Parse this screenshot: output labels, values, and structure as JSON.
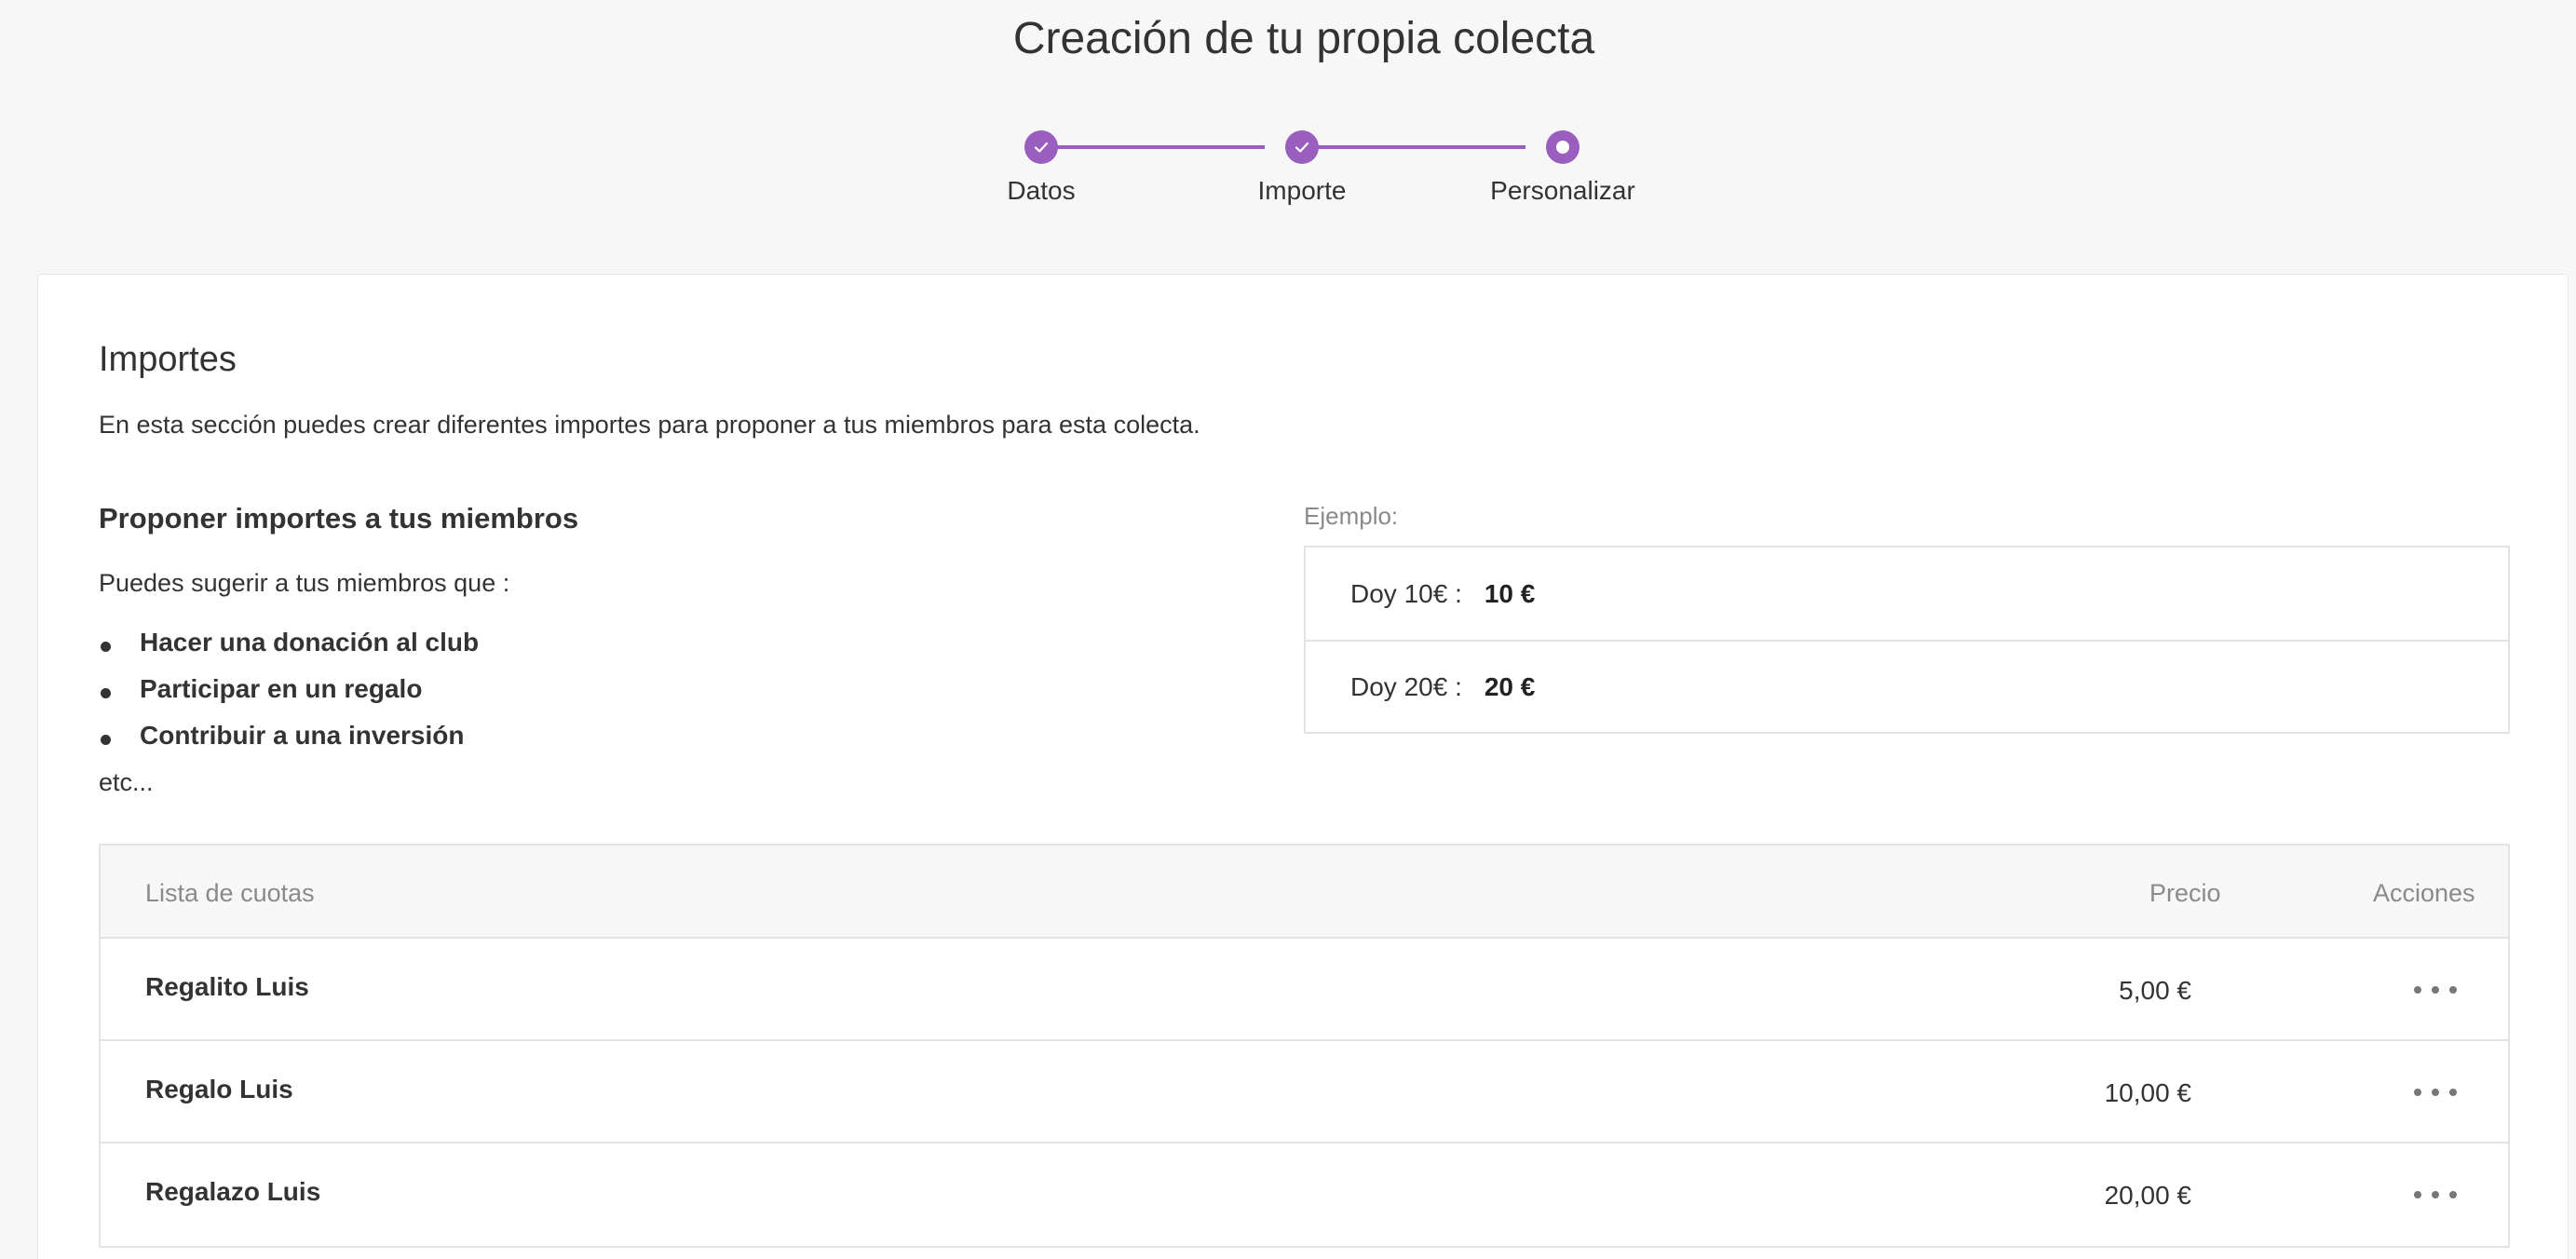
{
  "page": {
    "title": "Creación de tu propia colecta"
  },
  "stepper": {
    "steps": [
      {
        "label": "Datos",
        "state": "done"
      },
      {
        "label": "Importe",
        "state": "done"
      },
      {
        "label": "Personalizar",
        "state": "current"
      }
    ],
    "accent_color": "#9a5ebf"
  },
  "section": {
    "title": "Importes",
    "description": "En esta sección puedes crear diferentes importes para proponer a tus miembros para esta colecta."
  },
  "propose": {
    "title": "Proponer importes a tus miembros",
    "intro": "Puedes sugerir a tus miembros que :",
    "bullets": [
      "Hacer una donación al club",
      "Participar en un regalo",
      "Contribuir a una inversión"
    ],
    "etc": "etc..."
  },
  "example": {
    "label": "Ejemplo:",
    "rows": [
      {
        "label": "Doy 10€ :",
        "value": "10 €"
      },
      {
        "label": "Doy 20€ :",
        "value": "20 €"
      }
    ]
  },
  "fees_table": {
    "headers": {
      "name": "Lista de cuotas",
      "price": "Precio",
      "actions": "Acciones"
    },
    "rows": [
      {
        "name": "Regalito Luis",
        "price": "5,00 €",
        "actions_icon": "more-dots-icon"
      },
      {
        "name": "Regalo Luis",
        "price": "10,00 €",
        "actions_icon": "more-dots-icon"
      },
      {
        "name": "Regalazo Luis",
        "price": "20,00 €",
        "actions_icon": "more-dots-icon"
      }
    ]
  }
}
